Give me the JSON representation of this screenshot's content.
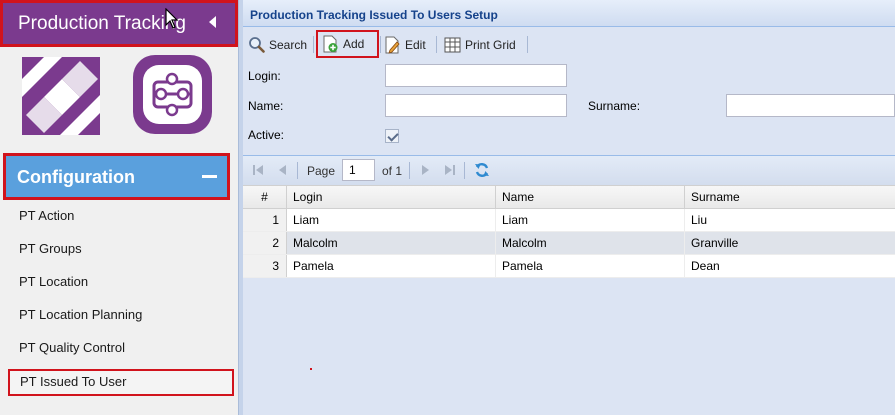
{
  "sidebar": {
    "app_title": "Production Tracking",
    "section_title": "Configuration",
    "items": [
      {
        "label": "PT Action"
      },
      {
        "label": "PT Groups"
      },
      {
        "label": "PT Location"
      },
      {
        "label": "PT Location Planning"
      },
      {
        "label": "PT Quality Control"
      },
      {
        "label": "PT Issued To User",
        "selected": true
      }
    ]
  },
  "main": {
    "title": "Production Tracking Issued To Users Setup",
    "toolbar": {
      "search_label": "Search",
      "add_label": "Add",
      "edit_label": "Edit",
      "print_label": "Print Grid"
    },
    "form": {
      "login_label": "Login:",
      "login_value": "",
      "name_label": "Name:",
      "name_value": "",
      "surname_label": "Surname:",
      "surname_value": "",
      "active_label": "Active:",
      "active_checked": true
    },
    "paging": {
      "page_label": "Page",
      "page_value": "1",
      "of_label": "of 1"
    },
    "grid": {
      "columns": [
        "#",
        "Login",
        "Name",
        "Surname"
      ],
      "rows": [
        {
          "num": "1",
          "login": "Liam",
          "name": "Liam",
          "surname": "Liu"
        },
        {
          "num": "2",
          "login": "Malcolm",
          "name": "Malcolm",
          "surname": "Granville",
          "selected": true
        },
        {
          "num": "3",
          "login": "Pamela",
          "name": "Pamela",
          "surname": "Dean"
        }
      ]
    }
  },
  "colors": {
    "brand_purple": "#7b3a8e",
    "config_blue": "#5aa0dd",
    "highlight_red": "#d1131c",
    "title_blue": "#15428b"
  },
  "icons": [
    "collapse-left-icon",
    "cursor-icon",
    "collapse-minus-icon",
    "search-icon",
    "add-icon",
    "edit-icon",
    "print-grid-icon",
    "first-page-icon",
    "prev-page-icon",
    "next-page-icon",
    "last-page-icon",
    "refresh-icon"
  ]
}
